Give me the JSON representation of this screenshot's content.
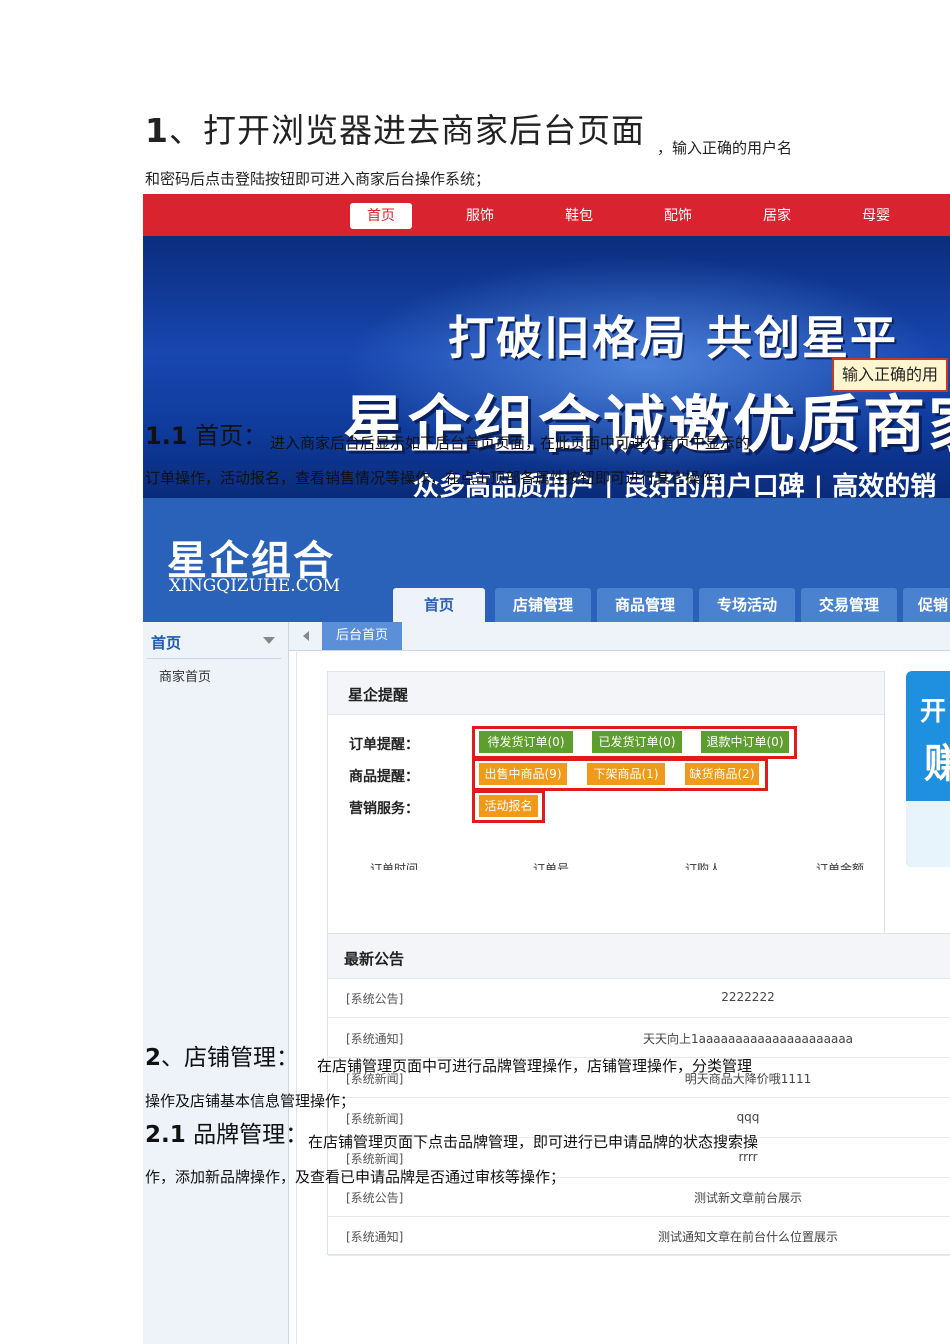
{
  "doc": {
    "h1_num": "1",
    "h1_text": "、打开浏览器进去商家后台页面",
    "h1_tail": "，输入正确的用户名",
    "h1_line2": "和密码后点击登陆按钮即可进入商家后台操作系统；",
    "s11_num": "1.1",
    "s11_text": "首页：",
    "s11_line1": "进入商家后台后显示如下后台首页页面，在此页面中可进行首页中显示的",
    "s11_line2": "订单操作，活动报名，查看销售情况等操作，在点击顶部各属性按钮即可进行其它操作；",
    "s2_num": "2",
    "s2_text": "、店铺管理：",
    "s2_line1": "在店铺管理页面中可进行品牌管理操作，店铺管理操作，分类管理",
    "s2_line2": "操作及店铺基本信息管理操作；",
    "s21_num": "2.1",
    "s21_text": "品牌管理：",
    "s21_line1": "在店铺管理页面下点击品牌管理，即可进行已申请品牌的状态搜索操",
    "s21_line2": "作，添加新品牌操作，及查看已申请品牌是否通过审核等操作；"
  },
  "storefront": {
    "nav": [
      "首页",
      "服饰",
      "鞋包",
      "配饰",
      "居家",
      "母婴"
    ],
    "banner_line1": "打破旧格局 共创星平",
    "banner_line2": "星企组合诚邀优质商家",
    "banner_line3": "众多高品质用户 | 良好的用户口碑 | 高效的销",
    "tooltip": "输入正确的用"
  },
  "admin": {
    "logo_cn": "星企组合",
    "logo_en": "XINGQIZUHE.COM",
    "tabs": [
      "首页",
      "店铺管理",
      "商品管理",
      "专场活动",
      "交易管理",
      "促销"
    ],
    "sidebar_title": "首页",
    "sidebar_item": "商家首页",
    "breadcrumb": "后台首页",
    "reminder_title": "星企提醒",
    "order_label": "订单提醒：",
    "order_btns": [
      "待发货订单(0)",
      "已发货订单(0)",
      "退款中订单(0)"
    ],
    "goods_label": "商品提醒：",
    "goods_btns": [
      "出售中商品(9)",
      "下架商品(1)",
      "缺货商品(2)"
    ],
    "marketing_label": "营销服务：",
    "marketing_btn": "活动报名",
    "cut_cols": [
      "订单时间",
      "订单号",
      "订购人",
      "订单金额"
    ],
    "card_k": "开",
    "card_k2": "赚",
    "announce_title": "最新公告",
    "announcements": [
      {
        "cat": "[系统公告]",
        "title": "2222222"
      },
      {
        "cat": "[系统通知]",
        "title": "天天向上1aaaaaaaaaaaaaaaaaaaaa"
      },
      {
        "cat": "[系统新闻]",
        "title": "明天商品大降价哦1111"
      },
      {
        "cat": "[系统新闻]",
        "title": "qqq"
      },
      {
        "cat": "[系统新闻]",
        "title": "rrrr"
      },
      {
        "cat": "[系统公告]",
        "title": "测试新文章前台展示"
      },
      {
        "cat": "[系统通知]",
        "title": "测试通知文章在前台什么位置展示"
      }
    ]
  },
  "colors": {
    "nav_red": "#d9242f",
    "admin_blue": "#2b62b9",
    "highlight_red": "#e01b1b",
    "green_btn": "#5e9e2e",
    "orange_btn": "#f19a1a"
  }
}
